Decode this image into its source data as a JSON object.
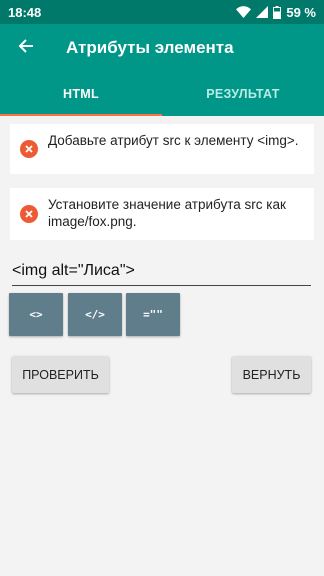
{
  "status_bar": {
    "time": "18:48",
    "battery": "59 %"
  },
  "app_bar": {
    "title": "Атрибуты элемента"
  },
  "tabs": [
    {
      "label": "HTML",
      "active": true
    },
    {
      "label": "РЕЗУЛЬТАТ",
      "active": false
    }
  ],
  "messages": [
    {
      "text": "Добавьте атрибут src к элементу <img>."
    },
    {
      "text": "Установите значение атрибута src как image/fox.png."
    }
  ],
  "code_input": {
    "value": "<img alt=\"Лиса\">"
  },
  "token_buttons": [
    {
      "label": "<>"
    },
    {
      "label": "</>"
    },
    {
      "label": "=\"\""
    }
  ],
  "actions": {
    "check": "ПРОВЕРИТЬ",
    "reset": "ВЕРНУТЬ"
  },
  "colors": {
    "primary": "#009688",
    "status": "#00796b",
    "accent": "#ff7043",
    "error": "#ec5b34",
    "token_button": "#607d8b"
  }
}
